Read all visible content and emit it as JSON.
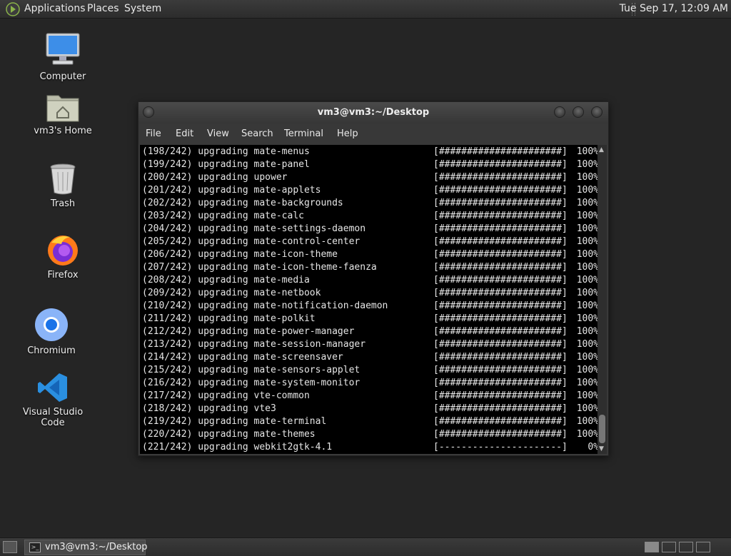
{
  "top_panel": {
    "menus": [
      "Applications",
      "Places",
      "System"
    ],
    "clock": "Tue Sep 17, 12:09 AM"
  },
  "desktop": {
    "icons": [
      {
        "label": "Computer",
        "icon": "computer-icon"
      },
      {
        "label": "vm3's Home",
        "icon": "home-folder-icon"
      },
      {
        "label": "Trash",
        "icon": "trash-icon"
      },
      {
        "label": "Firefox",
        "icon": "firefox-icon"
      },
      {
        "label": "Chromium",
        "icon": "chromium-icon"
      },
      {
        "label": "Visual Studio Code",
        "icon": "vscode-icon"
      }
    ]
  },
  "terminal": {
    "title": "vm3@vm3:~/Desktop",
    "menu": [
      "File",
      "Edit",
      "View",
      "Search",
      "Terminal",
      "Help"
    ],
    "lines": [
      {
        "text": "(198/242) upgrading mate-menus",
        "bar": "[######################]",
        "pct": "100%"
      },
      {
        "text": "(199/242) upgrading mate-panel",
        "bar": "[######################]",
        "pct": "100%"
      },
      {
        "text": "(200/242) upgrading upower",
        "bar": "[######################]",
        "pct": "100%"
      },
      {
        "text": "(201/242) upgrading mate-applets",
        "bar": "[######################]",
        "pct": "100%"
      },
      {
        "text": "(202/242) upgrading mate-backgrounds",
        "bar": "[######################]",
        "pct": "100%"
      },
      {
        "text": "(203/242) upgrading mate-calc",
        "bar": "[######################]",
        "pct": "100%"
      },
      {
        "text": "(204/242) upgrading mate-settings-daemon",
        "bar": "[######################]",
        "pct": "100%"
      },
      {
        "text": "(205/242) upgrading mate-control-center",
        "bar": "[######################]",
        "pct": "100%"
      },
      {
        "text": "(206/242) upgrading mate-icon-theme",
        "bar": "[######################]",
        "pct": "100%"
      },
      {
        "text": "(207/242) upgrading mate-icon-theme-faenza",
        "bar": "[######################]",
        "pct": "100%"
      },
      {
        "text": "(208/242) upgrading mate-media",
        "bar": "[######################]",
        "pct": "100%"
      },
      {
        "text": "(209/242) upgrading mate-netbook",
        "bar": "[######################]",
        "pct": "100%"
      },
      {
        "text": "(210/242) upgrading mate-notification-daemon",
        "bar": "[######################]",
        "pct": "100%"
      },
      {
        "text": "(211/242) upgrading mate-polkit",
        "bar": "[######################]",
        "pct": "100%"
      },
      {
        "text": "(212/242) upgrading mate-power-manager",
        "bar": "[######################]",
        "pct": "100%"
      },
      {
        "text": "(213/242) upgrading mate-session-manager",
        "bar": "[######################]",
        "pct": "100%"
      },
      {
        "text": "(214/242) upgrading mate-screensaver",
        "bar": "[######################]",
        "pct": "100%"
      },
      {
        "text": "(215/242) upgrading mate-sensors-applet",
        "bar": "[######################]",
        "pct": "100%"
      },
      {
        "text": "(216/242) upgrading mate-system-monitor",
        "bar": "[######################]",
        "pct": "100%"
      },
      {
        "text": "(217/242) upgrading vte-common",
        "bar": "[######################]",
        "pct": "100%"
      },
      {
        "text": "(218/242) upgrading vte3",
        "bar": "[######################]",
        "pct": "100%"
      },
      {
        "text": "(219/242) upgrading mate-terminal",
        "bar": "[######################]",
        "pct": "100%"
      },
      {
        "text": "(220/242) upgrading mate-themes",
        "bar": "[######################]",
        "pct": "100%"
      },
      {
        "text": "(221/242) upgrading webkit2gtk-4.1",
        "bar": "[----------------------]",
        "pct": "0%"
      }
    ]
  },
  "bottom_panel": {
    "task_label": "vm3@vm3:~/Desktop"
  },
  "colors": {
    "desktop_bg": "#252525",
    "terminal_bg": "#000000",
    "terminal_fg": "#e6e6e6",
    "vscode_blue": "#2a8fe0",
    "firefox_orange": "#ff7a1a"
  }
}
